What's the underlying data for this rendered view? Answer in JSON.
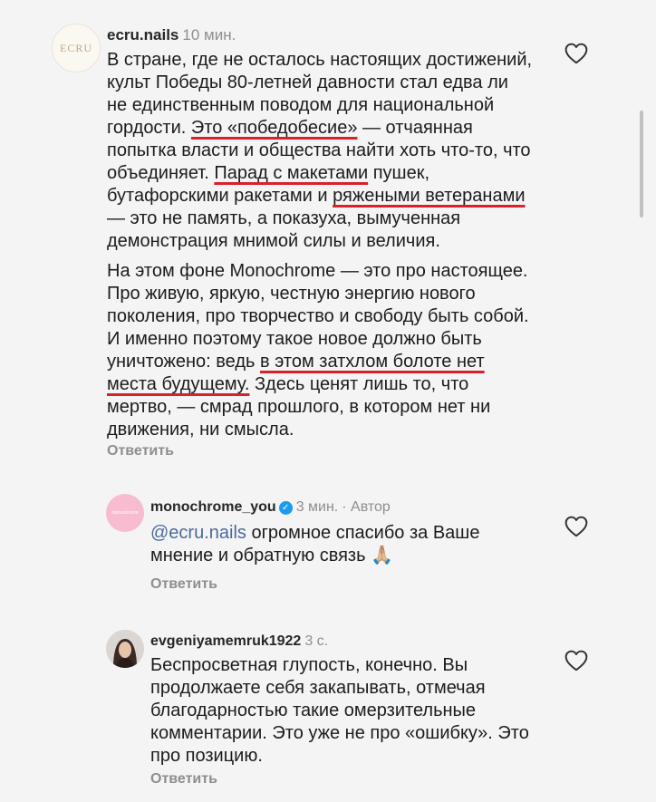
{
  "comments": [
    {
      "username": "ecru.nails",
      "time": "10 мин.",
      "avatar_label": "ECRU",
      "paragraphs": [
        [
          {
            "text": "В стране, где не осталось настоящих достижений, культ Победы 80-летней давности стал едва ли не единственным поводом для национальной гордости. "
          },
          {
            "text": "Это «победобесие»",
            "underline": true
          },
          {
            "text": " — отчаянная попытка власти и общества найти хоть что-то, что объединяет. "
          },
          {
            "text": "Парад с макетами",
            "underline": true
          },
          {
            "text": " пушек, бутафорскими ракетами и "
          },
          {
            "text": "ряжеными ветеранами",
            "underline": true
          },
          {
            "text": " — это не память, а показуха, вымученная демонстрация мнимой силы и величия."
          }
        ],
        [
          {
            "text": "На этом фоне Monochrome — это про настоящее. Про живую, яркую, честную энергию нового поколения, про творчество и свободу быть собой. И именно поэтому такое новое должно быть уничтожено: ведь "
          },
          {
            "text": "в этом затхлом болоте нет места будущему.",
            "underline": true
          },
          {
            "text": " Здесь ценят лишь то, что мертво, — смрад прошлого, в котором нет ни движения, ни смысла."
          }
        ]
      ],
      "reply_label": "Ответить"
    },
    {
      "username": "monochrome_you",
      "time": "3 мин.",
      "badge": "· Автор",
      "avatar_label": "monochrome",
      "mention": "@ecru.nails",
      "text": " огромное спасибо за Ваше мнение и обратную связь 🙏🏼",
      "reply_label": "Ответить"
    },
    {
      "username": "evgeniyamemruk1922",
      "time": "3 с.",
      "text": "Беспросветная глупость, конечно. Вы продолжаете себя закапывать, отмечая благодарностью такие омерзительные комментарии. Это уже не про «ошибку». Это про позицию.",
      "reply_label": "Ответить"
    }
  ],
  "colors": {
    "background": "#f4f4f4",
    "underline": "#d9212a",
    "mention": "#4a6a9c",
    "meta": "#8e8e8e"
  },
  "icons": [
    "heart-icon",
    "verified-icon"
  ]
}
